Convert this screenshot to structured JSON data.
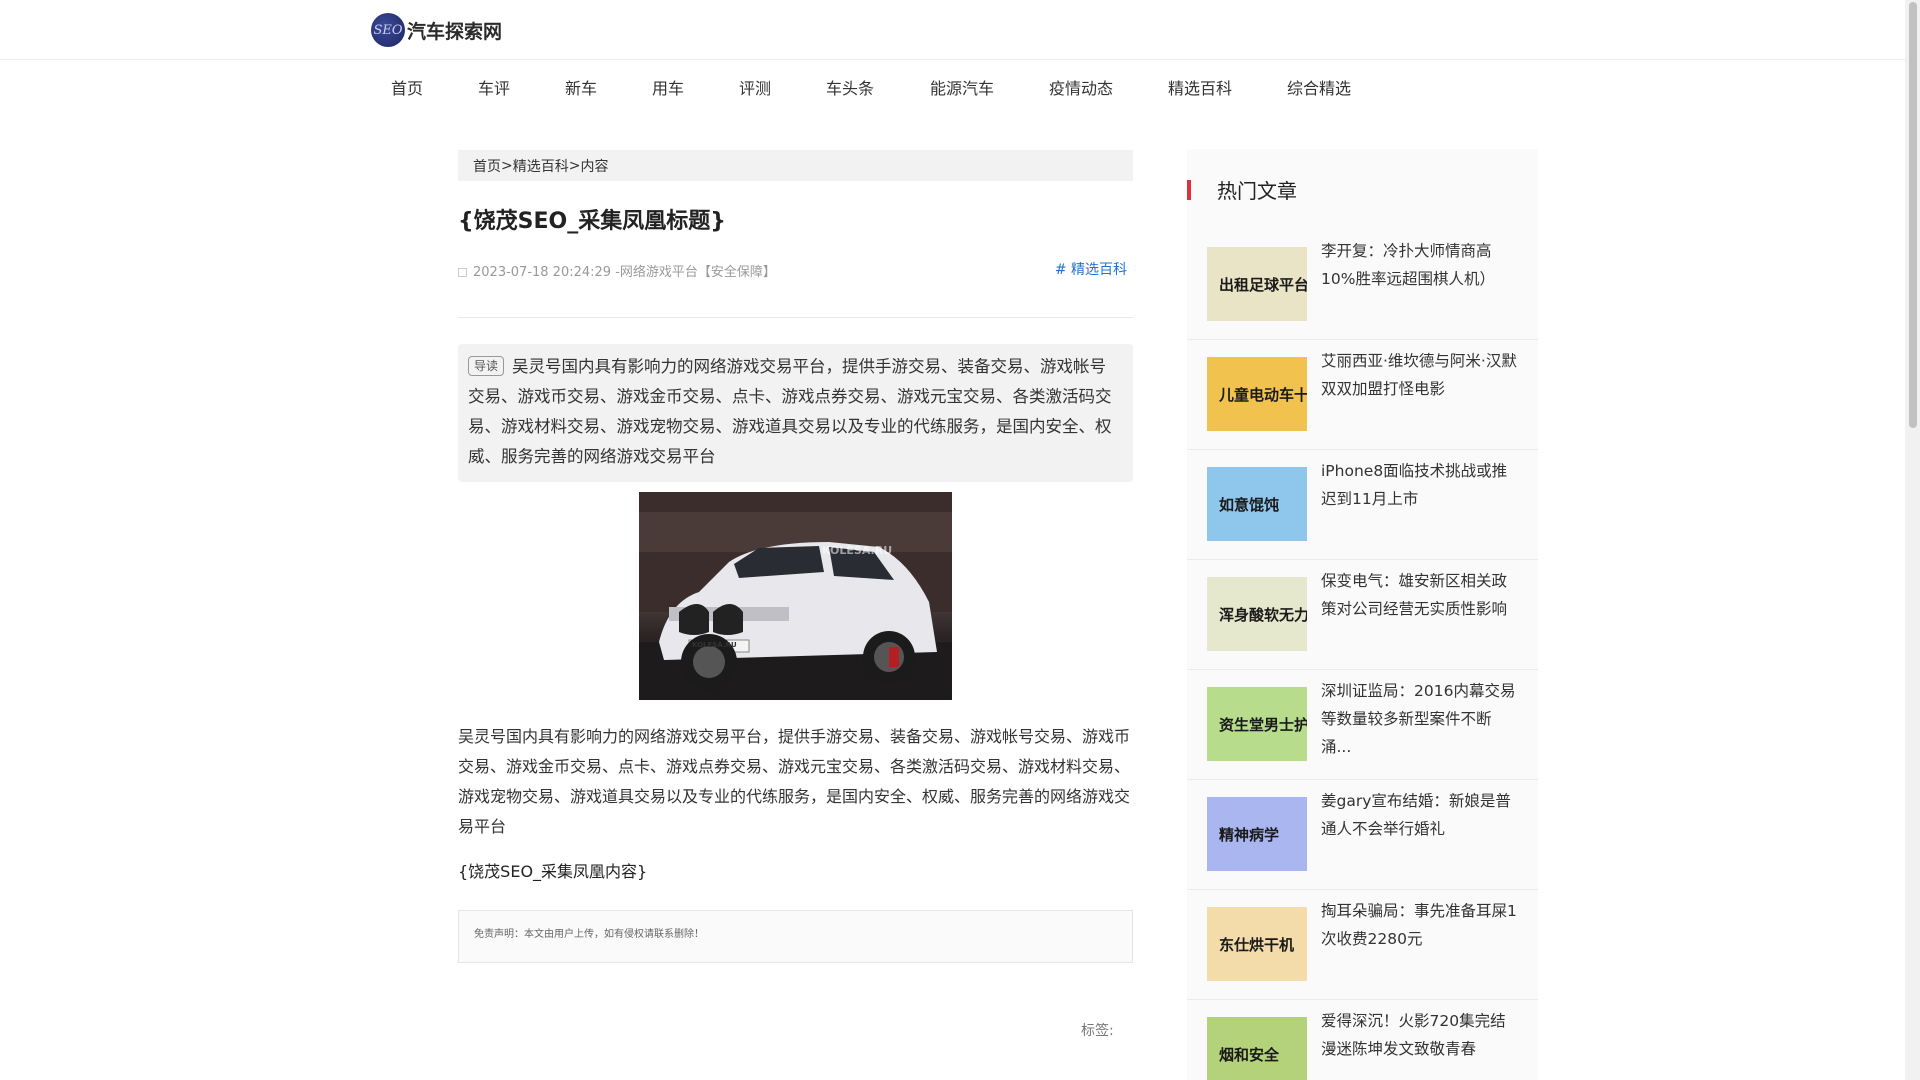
{
  "header": {
    "logo_text": "汽车探索网",
    "logo_mark": "SEO"
  },
  "nav": [
    {
      "label": "首页"
    },
    {
      "label": "车评"
    },
    {
      "label": "新车"
    },
    {
      "label": "用车"
    },
    {
      "label": "评测"
    },
    {
      "label": "车头条"
    },
    {
      "label": "能源汽车"
    },
    {
      "label": "疫情动态"
    },
    {
      "label": "精选百科"
    },
    {
      "label": "综合精选"
    }
  ],
  "breadcrumb": {
    "home": "首页",
    "sep1": " >",
    "category": "精选百科",
    "sep2": " > ",
    "current": "内容"
  },
  "article": {
    "title": "{饶茂SEO_采集凤凰标题}",
    "meta": "2023-07-18 20:24:29 -网络游戏平台【安全保障】",
    "category_tag": "# 精选百科",
    "lead_badge": "导读",
    "lead": "吴灵号国内具有影响力的网络游戏交易平台，提供手游交易、装备交易、游戏帐号交易、游戏币交易、游戏金币交易、点卡、游戏点券交易、游戏元宝交易、各类激活码交易、游戏材料交易、游戏宠物交易、游戏道具交易以及专业的代练服务，是国内安全、权威、服务完善的网络游戏交易平台",
    "body": "吴灵号国内具有影响力的网络游戏交易平台，提供手游交易、装备交易、游戏帐号交易、游戏币交易、游戏金币交易、点卡、游戏点券交易、游戏元宝交易、各类激活码交易、游戏材料交易、游戏宠物交易、游戏道具交易以及专业的代练服务，是国内安全、权威、服务完善的网络游戏交易平台",
    "body_template": "{饶茂SEO_采集凤凰内容}",
    "image_watermark": "KOLESA.RU",
    "plate_text": "KOLESA.RU",
    "disclaimer": "免责声明：本文由用户上传，如有侵权请联系删除！",
    "tags_label": "标签:"
  },
  "sidebar": {
    "title": "热门文章",
    "items": [
      {
        "thumb_text": "出租足球平台",
        "title": "李开复：冷扑大师情商高10%胜率远超围棋人机）",
        "bg": "#e9e4c6"
      },
      {
        "thumb_text": "儿童电动车十 车品牌排行榜",
        "title": "艾丽西亚·维坎德与阿米·汉默双双加盟打怪电影",
        "bg": "#f2c24f"
      },
      {
        "thumb_text": "如意馄饨",
        "title": "iPhone8面临技术挑战或推迟到11月上市",
        "bg": "#8ec6ec"
      },
      {
        "thumb_text": "浑身酸软无力 发冷怎么回事",
        "title": "保变电气：雄安新区相关政策对公司经营无实质性影响",
        "bg": "#e6e8cd"
      },
      {
        "thumb_text": "资生堂男士护肤品 样）",
        "title": "深圳证监局：2016内幕交易等数量较多新型案件不断涌...",
        "bg": "#b7dc8c"
      },
      {
        "thumb_text": "精神病学",
        "title": "姜gary宣布结婚：新娘是普通人不会举行婚礼",
        "bg": "#a9b6f0"
      },
      {
        "thumb_text": "东仕烘干机",
        "title": "掏耳朵骗局：事先准备耳屎1次收费2280元",
        "bg": "#f3dca9"
      },
      {
        "thumb_text": "烟和安全",
        "title": "爱得深沉！火影720集完结漫迷陈坤发文致敬青春",
        "bg": "#b4d27a"
      }
    ]
  }
}
